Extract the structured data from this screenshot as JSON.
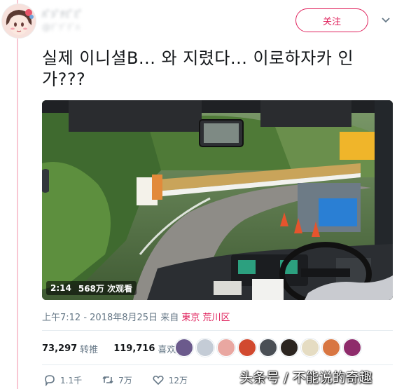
{
  "user": {
    "name": "ﾊﾞｼﾞﾅﾐﾞﾐﾞ",
    "handle": "@ﾃﾞﾂﾞﾃﾞﾊ"
  },
  "follow_label": "关注",
  "tweet_text": "실제 이니셜B... 와 지렸다... 이로하자카 인가???",
  "video": {
    "duration": "2:14",
    "views": "568万 次观看"
  },
  "meta": {
    "time": "上午7:12 - 2018年8月25日",
    "from": "来自",
    "location": "東京 荒川区"
  },
  "stats": {
    "retweets": "73,297",
    "retweets_label": "转推",
    "likes": "119,716",
    "likes_label": "喜欢"
  },
  "liker_colors": [
    "#6b5a8c",
    "#c4ccd6",
    "#e9a7a1",
    "#d1492f",
    "#4a4f55",
    "#2c2520",
    "#e5dcc2",
    "#d87642",
    "#8e2b6b"
  ],
  "actions": {
    "replies": "1.1千",
    "retweets": "7万",
    "likes": "12万"
  },
  "watermark": "头条号 / 不能说的奇趣",
  "colors": {
    "accent": "#e0245e",
    "text": "#14171a",
    "muted": "#657786"
  }
}
